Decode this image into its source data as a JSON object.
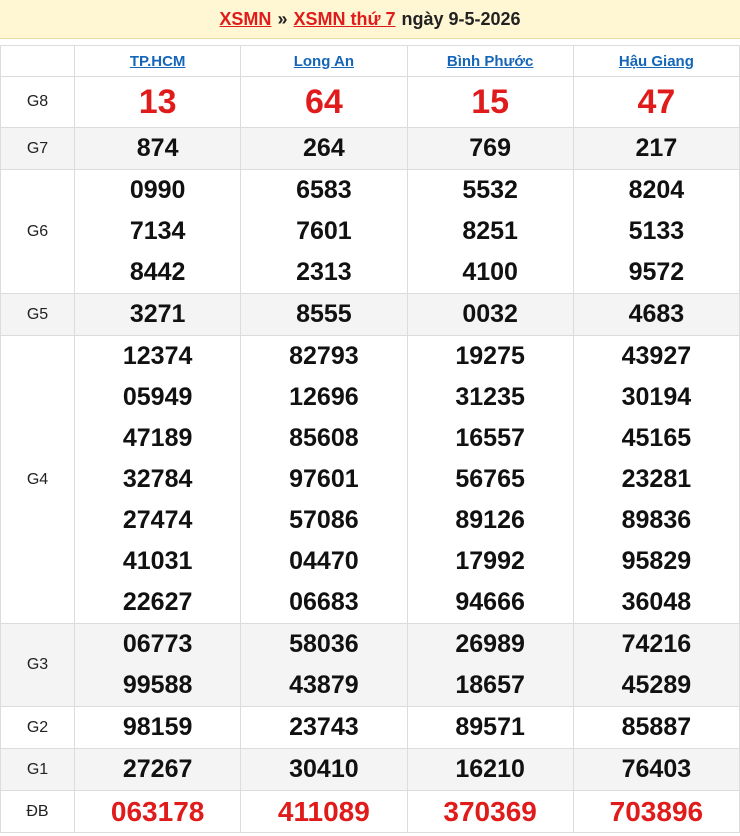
{
  "header": {
    "link1": "XSMN",
    "sep": "»",
    "link2": "XSMN thứ 7",
    "date": "ngày 9-5-2026"
  },
  "provinces": [
    "TP.HCM",
    "Long An",
    "Bình Phước",
    "Hậu Giang"
  ],
  "prizes": {
    "G8": {
      "label": "G8",
      "values": [
        [
          "13"
        ],
        [
          "64"
        ],
        [
          "15"
        ],
        [
          "47"
        ]
      ]
    },
    "G7": {
      "label": "G7",
      "values": [
        [
          "874"
        ],
        [
          "264"
        ],
        [
          "769"
        ],
        [
          "217"
        ]
      ]
    },
    "G6": {
      "label": "G6",
      "values": [
        [
          "0990",
          "7134",
          "8442"
        ],
        [
          "6583",
          "7601",
          "2313"
        ],
        [
          "5532",
          "8251",
          "4100"
        ],
        [
          "8204",
          "5133",
          "9572"
        ]
      ]
    },
    "G5": {
      "label": "G5",
      "values": [
        [
          "3271"
        ],
        [
          "8555"
        ],
        [
          "0032"
        ],
        [
          "4683"
        ]
      ]
    },
    "G4": {
      "label": "G4",
      "values": [
        [
          "12374",
          "05949",
          "47189",
          "32784",
          "27474",
          "41031",
          "22627"
        ],
        [
          "82793",
          "12696",
          "85608",
          "97601",
          "57086",
          "04470",
          "06683"
        ],
        [
          "19275",
          "31235",
          "16557",
          "56765",
          "89126",
          "17992",
          "94666"
        ],
        [
          "43927",
          "30194",
          "45165",
          "23281",
          "89836",
          "95829",
          "36048"
        ]
      ]
    },
    "G3": {
      "label": "G3",
      "values": [
        [
          "06773",
          "99588"
        ],
        [
          "58036",
          "43879"
        ],
        [
          "26989",
          "18657"
        ],
        [
          "74216",
          "45289"
        ]
      ]
    },
    "G2": {
      "label": "G2",
      "values": [
        [
          "98159"
        ],
        [
          "23743"
        ],
        [
          "89571"
        ],
        [
          "85887"
        ]
      ]
    },
    "G1": {
      "label": "G1",
      "values": [
        [
          "27267"
        ],
        [
          "30410"
        ],
        [
          "16210"
        ],
        [
          "76403"
        ]
      ]
    },
    "DB": {
      "label": "ĐB",
      "values": [
        [
          "063178"
        ],
        [
          "411089"
        ],
        [
          "370369"
        ],
        [
          "703896"
        ]
      ]
    }
  }
}
